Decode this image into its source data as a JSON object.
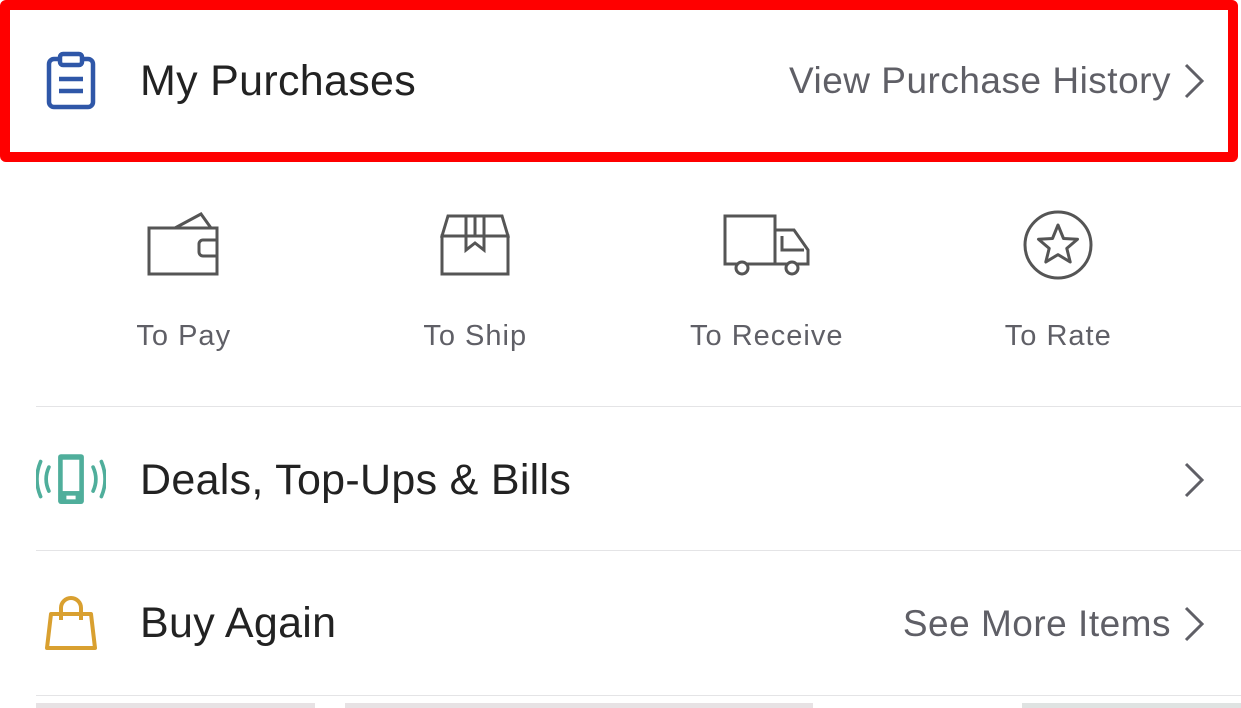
{
  "purchases": {
    "title": "My Purchases",
    "action_label": "View Purchase History",
    "icon": "clipboard-icon"
  },
  "statuses": [
    {
      "label": "To Pay",
      "icon": "wallet-icon"
    },
    {
      "label": "To Ship",
      "icon": "box-icon"
    },
    {
      "label": "To Receive",
      "icon": "truck-icon"
    },
    {
      "label": "To Rate",
      "icon": "star-icon"
    }
  ],
  "deals": {
    "title": "Deals, Top-Ups & Bills",
    "icon": "phone-signal-icon"
  },
  "buy_again": {
    "title": "Buy Again",
    "action_label": "See More Items",
    "icon": "shopping-bag-icon"
  },
  "colors": {
    "highlight": "#ff0000",
    "clipboard_blue": "#2f57a8",
    "phone_teal": "#4fae9b",
    "bag_gold": "#d9a030",
    "text_primary": "#222222",
    "text_secondary": "#5f5f66"
  }
}
